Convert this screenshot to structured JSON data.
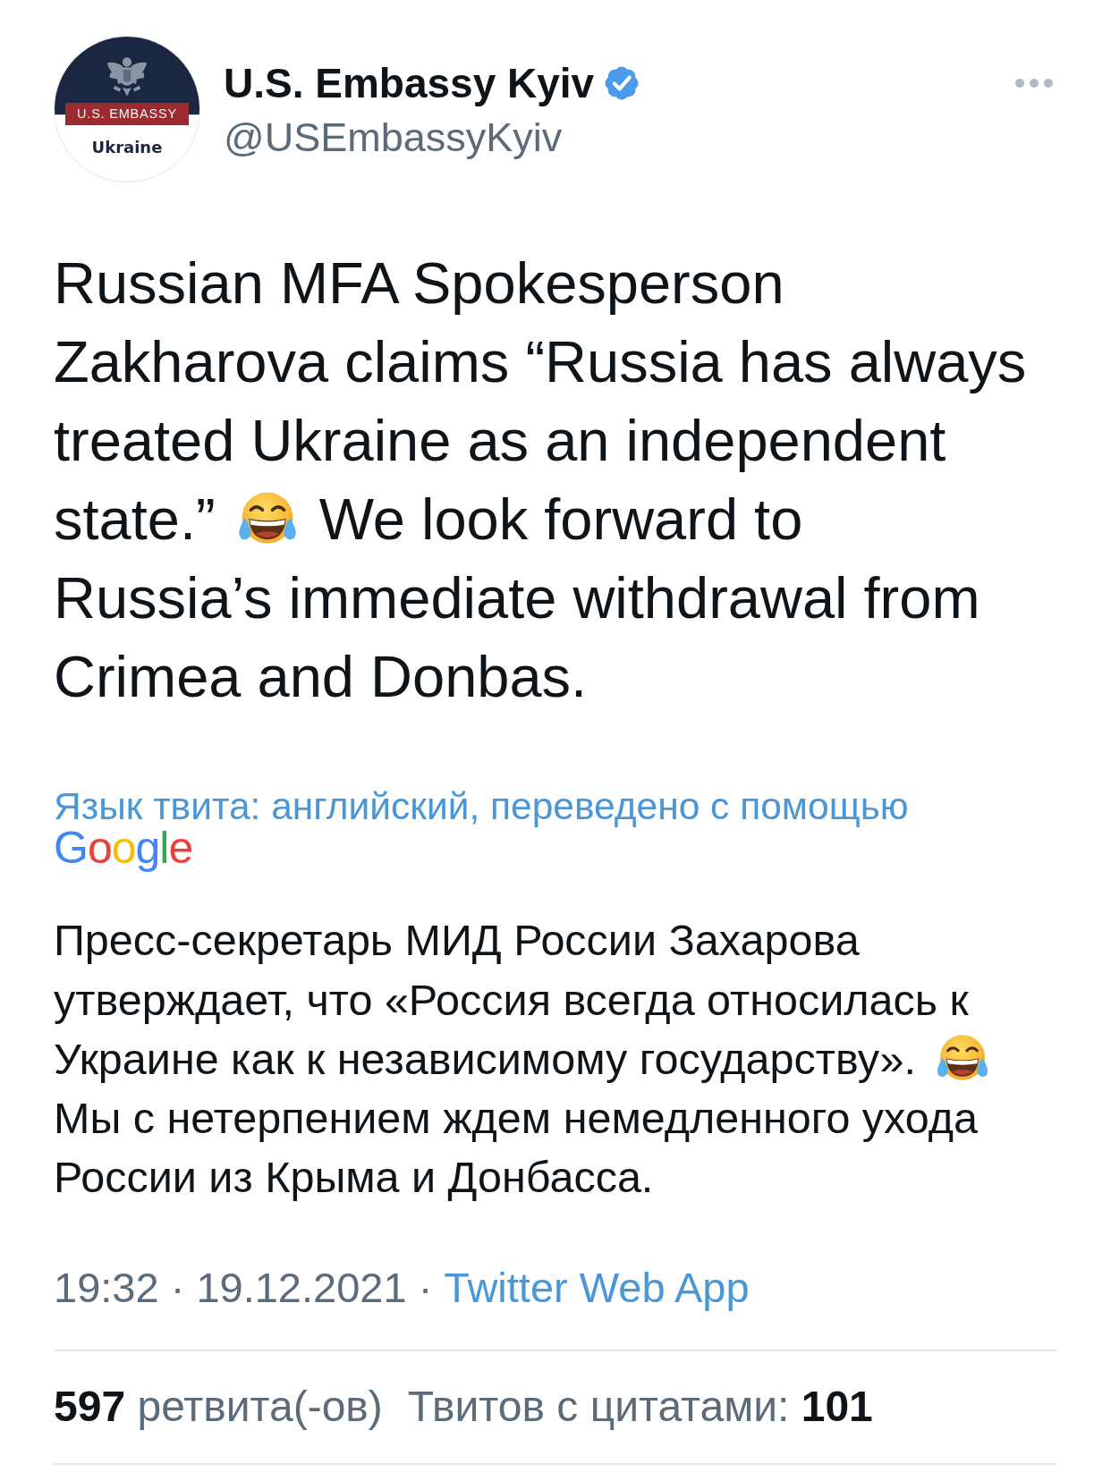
{
  "author": {
    "avatar": {
      "banner": "U.S. EMBASSY",
      "caption": "Ukraine"
    },
    "name": "U.S. Embassy Kyiv",
    "verified": true,
    "handle": "@USEmbassyKyiv"
  },
  "tweet": {
    "lines": [
      {
        "parts": [
          {
            "kind": "text",
            "text": "Russian MFA Spokesperson"
          }
        ]
      },
      {
        "parts": [
          {
            "kind": "text",
            "text": "Zakharova claims “Russia has always"
          }
        ]
      },
      {
        "parts": [
          {
            "kind": "text",
            "text": "treated Ukraine as an independent"
          }
        ]
      },
      {
        "parts": [
          {
            "kind": "text",
            "text": "state.”"
          },
          {
            "kind": "emoji"
          },
          {
            "kind": "text",
            "text": "We look forward to"
          }
        ]
      },
      {
        "parts": [
          {
            "kind": "text",
            "text": "Russia’s immediate withdrawal from"
          }
        ]
      },
      {
        "parts": [
          {
            "kind": "text",
            "text": "Crimea and Donbas."
          }
        ]
      }
    ]
  },
  "translation": {
    "note": "Язык твита: английский, переведено с помощью",
    "provider": "Google",
    "lines": [
      {
        "parts": [
          {
            "kind": "text",
            "text": "Пресс-секретарь МИД России Захарова"
          }
        ]
      },
      {
        "parts": [
          {
            "kind": "text",
            "text": "утверждает, что «Россия всегда относилась к"
          }
        ]
      },
      {
        "parts": [
          {
            "kind": "text",
            "text": "Украине как к независимому государству»."
          },
          {
            "kind": "emoji"
          }
        ]
      },
      {
        "parts": [
          {
            "kind": "text",
            "text": "Мы с нетерпением ждем немедленного ухода"
          }
        ]
      },
      {
        "parts": [
          {
            "kind": "text",
            "text": "России из Крыма и Донбасса."
          }
        ]
      }
    ]
  },
  "meta": {
    "timestamp": "19:32 · 19.12.2021",
    "separator": "·",
    "source": "Twitter Web App"
  },
  "stats": [
    {
      "count": "597",
      "label": "ретвита(-ов)",
      "count_first": true
    },
    {
      "count": "101",
      "label": "Твитов с цитатами:",
      "count_first": false
    }
  ]
}
